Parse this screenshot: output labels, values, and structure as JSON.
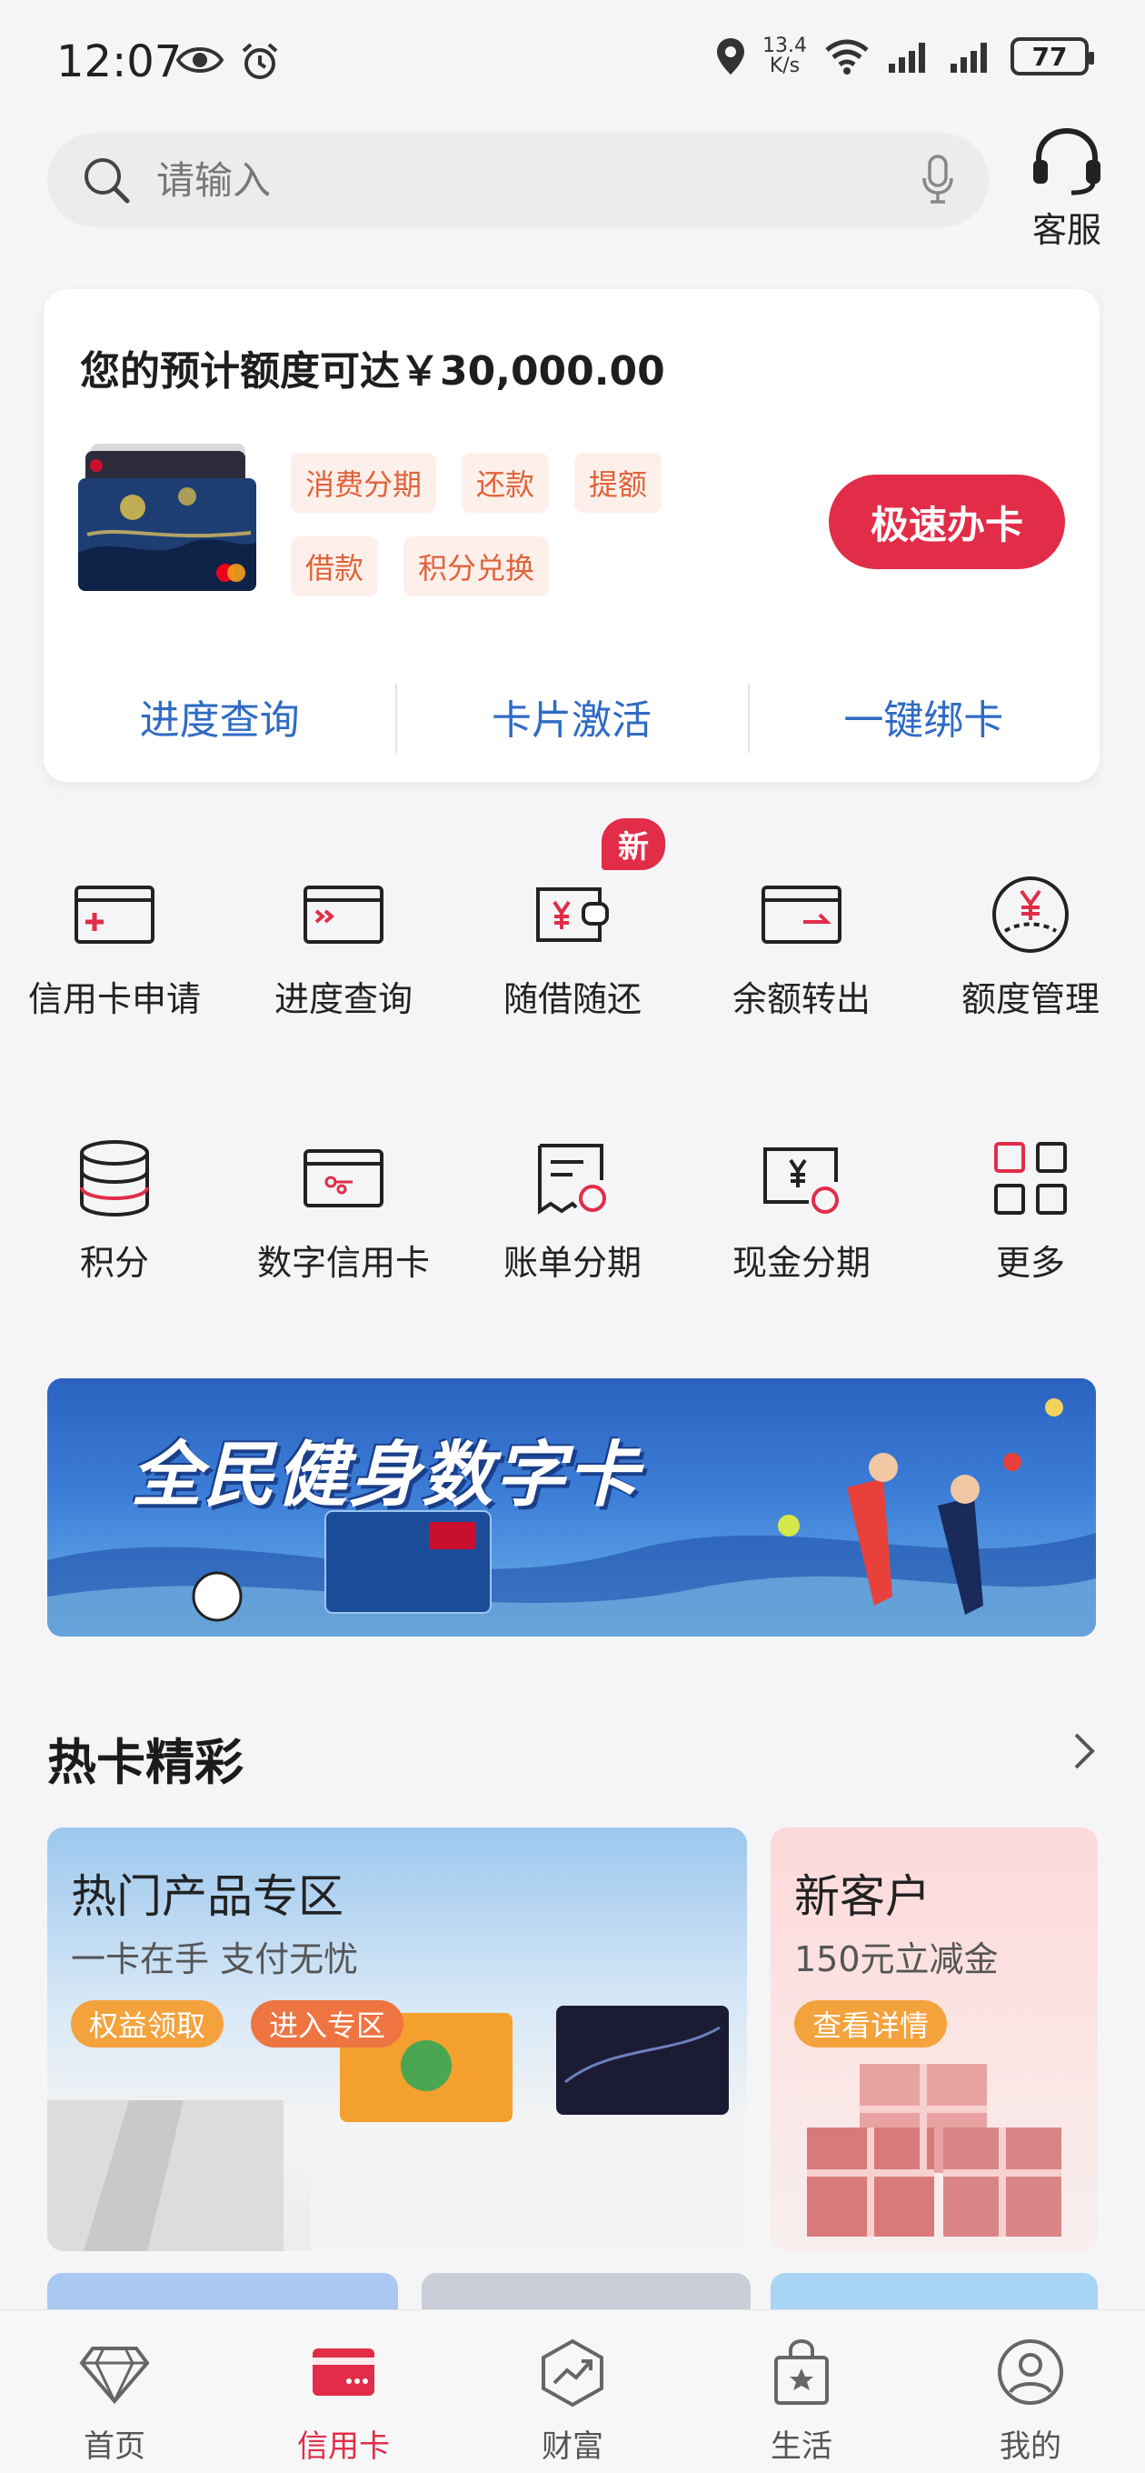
{
  "status_bar": {
    "time": "12:07",
    "net_speed_value": "13.4",
    "net_speed_unit": "K/s",
    "battery": "77"
  },
  "search": {
    "placeholder": "请输入"
  },
  "service": {
    "label": "客服"
  },
  "credit_card": {
    "limit_text": "您的预计额度可达￥30,000.00",
    "tags": [
      "消费分期",
      "还款",
      "提额",
      "借款",
      "积分兑换"
    ],
    "apply_button": "极速办卡",
    "links": [
      "进度查询",
      "卡片激活",
      "一键绑卡"
    ]
  },
  "grid": {
    "badge_new": "新",
    "row1": [
      {
        "label": "信用卡申请",
        "icon": "card-plus-icon"
      },
      {
        "label": "进度查询",
        "icon": "card-progress-icon"
      },
      {
        "label": "随借随还",
        "icon": "wallet-yuan-icon"
      },
      {
        "label": "余额转出",
        "icon": "card-transfer-icon"
      },
      {
        "label": "额度管理",
        "icon": "yuan-circle-icon"
      }
    ],
    "row2": [
      {
        "label": "积分",
        "icon": "coin-stack-icon"
      },
      {
        "label": "数字信用卡",
        "icon": "digital-card-icon"
      },
      {
        "label": "账单分期",
        "icon": "bill-installment-icon"
      },
      {
        "label": "现金分期",
        "icon": "cash-installment-icon"
      },
      {
        "label": "更多",
        "icon": "more-grid-icon"
      }
    ]
  },
  "banner": {
    "title": "全民健身数字卡"
  },
  "hot_cards": {
    "title": "热卡精彩",
    "left": {
      "title": "热门产品专区",
      "subtitle": "一卡在手 支付无忧",
      "btn1": "权益领取",
      "btn2": "进入专区"
    },
    "right": {
      "title": "新客户",
      "subtitle": "150元立减金",
      "btn": "查看详情"
    }
  },
  "bottom_nav": {
    "items": [
      {
        "label": "首页",
        "icon": "diamond-icon"
      },
      {
        "label": "信用卡",
        "icon": "credit-card-icon"
      },
      {
        "label": "财富",
        "icon": "chart-up-icon"
      },
      {
        "label": "生活",
        "icon": "shopping-bag-icon"
      },
      {
        "label": "我的",
        "icon": "user-icon"
      }
    ],
    "active_index": 1
  },
  "colors": {
    "accent": "#e22d48",
    "link": "#2f6bc3",
    "tag_text": "#e1623a",
    "tag_bg": "#fdf0ea"
  }
}
